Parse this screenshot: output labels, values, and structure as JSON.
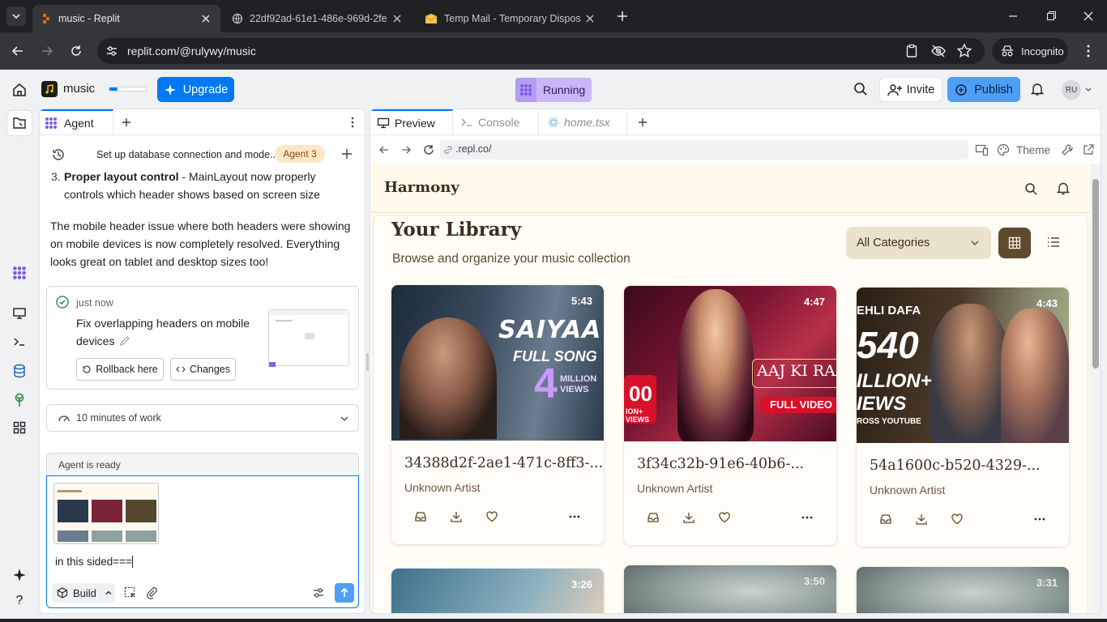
{
  "browser": {
    "tabs": [
      {
        "title": "music - Replit",
        "active": true
      },
      {
        "title": "22df92ad-61e1-486e-969d-2fe",
        "active": false
      },
      {
        "title": "Temp Mail - Temporary Dispos",
        "active": false
      }
    ],
    "url": "replit.com/@rulywy/music",
    "incognito_label": "Incognito"
  },
  "replit": {
    "project_name": "music",
    "upgrade_label": "Upgrade",
    "status_label": "Running",
    "invite_label": "Invite",
    "publish_label": "Publish",
    "avatar_initials": "RU"
  },
  "agent": {
    "tab_label": "Agent",
    "thread_title": "Set up database connection and mode...",
    "thread_badge": "Agent 3",
    "list_item_num": "3.",
    "list_item_bold": "Proper layout control",
    "list_item_rest": " - MainLayout now properly controls which header shows based on screen size",
    "paragraph": "The mobile header issue where both headers were showing on mobile devices is now completely resolved. Everything looks great on tablet and desktop sizes too!",
    "checkpoint_time": "just now",
    "checkpoint_title": "Fix overlapping headers on mobile devices",
    "rollback_label": "Rollback here",
    "changes_label": "Changes",
    "work_label": "10 minutes of work",
    "ready_label": "Agent is ready",
    "input_text": "in this sided===",
    "build_label": "Build"
  },
  "preview": {
    "tabs": [
      "Preview",
      "Console",
      "home.tsx"
    ],
    "url": ".repl.co/",
    "theme_label": "Theme"
  },
  "app": {
    "brand": "Harmony",
    "heading": "Your Library",
    "subheading": "Browse and organize your music collection",
    "category_select": "All Categories",
    "cards": [
      {
        "title": "34388d2f-2ae1-471c-8ff3-...",
        "artist": "Unknown Artist",
        "duration": "5:43",
        "art_line1": "SAIYAA",
        "art_line2": "FULL SONG",
        "art_big": "4",
        "art_small": "MILLION VIEWS"
      },
      {
        "title": "3f34c32b-91e6-40b6-...",
        "artist": "Unknown Artist",
        "duration": "4:47",
        "art_line1": "AAJ KI RAA",
        "art_line2": "FULL VIDEO",
        "art_big": "00",
        "art_small": "ION+ VIEWS"
      },
      {
        "title": "54a1600c-b520-4329-...",
        "artist": "Unknown Artist",
        "duration": "4:43",
        "art_line1": "EHLI DAFA",
        "art_line2": "ROSS YOUTUBE",
        "art_big": "540",
        "art_small": "ILLION+ IEWS"
      }
    ],
    "row2_durations": [
      "3:26",
      "3:50",
      "3:31"
    ]
  },
  "colors": {
    "accent_blue": "#0079f2",
    "running_purple": "#c9b8f5",
    "app_bg": "#fffaeb",
    "brown_dark": "#5e4a2c"
  }
}
